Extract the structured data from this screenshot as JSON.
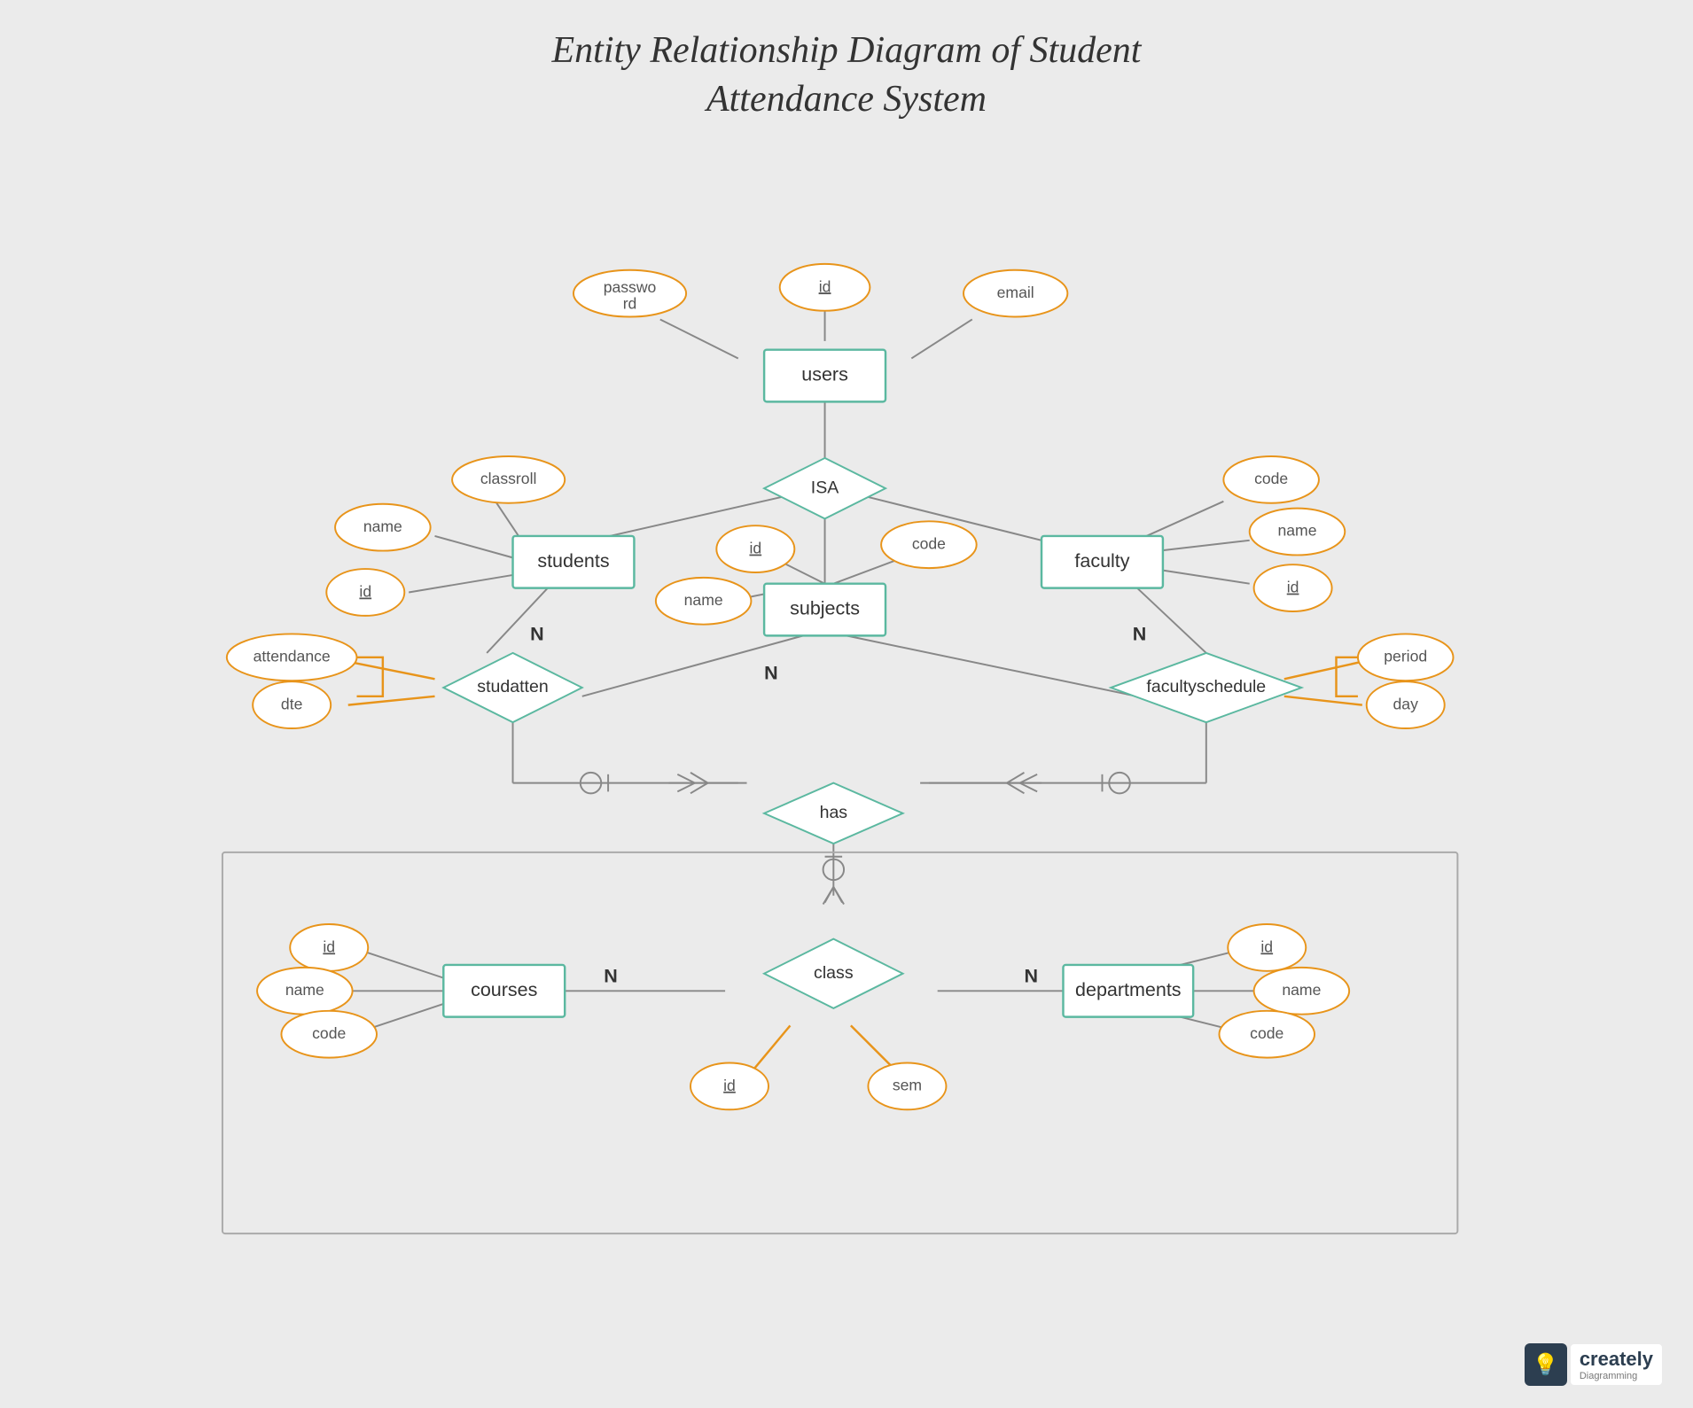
{
  "title": {
    "line1": "Entity Relationship Diagram of Student",
    "line2": "Attendance System"
  },
  "entities": {
    "users": "users",
    "students": "students",
    "faculty": "faculty",
    "subjects": "subjects",
    "courses": "courses",
    "departments": "departments",
    "class": "class"
  },
  "relationships": {
    "isa": "ISA",
    "studatten": "studatten",
    "has": "has",
    "facultyschedule": "facultyschedule"
  },
  "attributes": {
    "users_id": "id",
    "users_password": "password",
    "users_email": "email",
    "students_name": "name",
    "students_id": "id",
    "students_classroll": "classroll",
    "faculty_code": "code",
    "faculty_name": "name",
    "faculty_id": "id",
    "subjects_id": "id",
    "subjects_name": "name",
    "subjects_code": "code",
    "studatten_attendance": "attendance",
    "studatten_dte": "dte",
    "facultyschedule_period": "period",
    "facultyschedule_day": "day",
    "courses_id": "id",
    "courses_name": "name",
    "courses_code": "code",
    "class_id": "id",
    "class_sem": "sem",
    "departments_id": "id",
    "departments_name": "name",
    "departments_code": "code"
  },
  "watermark": {
    "brand": "creately",
    "sub": "Diagramming"
  }
}
